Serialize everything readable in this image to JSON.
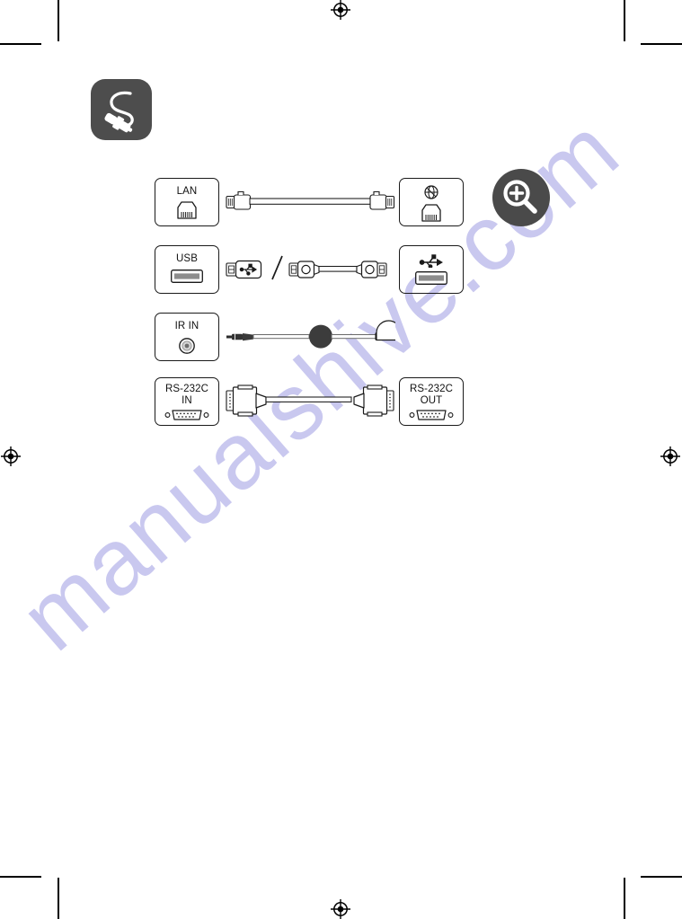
{
  "page": {
    "type": "manual-connection-guide",
    "background_color": "#ffffff",
    "ink_color": "#1a1a1a"
  },
  "watermark": {
    "text": "manualshive.com",
    "color": "#c9c8ef",
    "rotation_deg": -41
  },
  "section_badge": {
    "icon": "cable-plug-icon",
    "background_color": "#4d4d4d",
    "glyph_color": "#ffffff"
  },
  "zoom_badge": {
    "icon": "magnifier-plus-icon",
    "background_color": "#4a4a4a",
    "glyph_color": "#ffffff"
  },
  "rows": [
    {
      "id": "lan",
      "source": {
        "label": "LAN",
        "label_lines": [
          "LAN"
        ],
        "icon": "rj45-jack-icon"
      },
      "cable": {
        "icon": "lan-ethernet-cable-icon",
        "description": "RJ45 ethernet patch cable"
      },
      "destination": {
        "label": "",
        "label_lines": [],
        "icon": "globe-network-rj45-icon"
      }
    },
    {
      "id": "usb",
      "source": {
        "label": "USB",
        "label_lines": [
          "USB"
        ],
        "icon": "usb-type-a-port-icon"
      },
      "cable": {
        "icon": "usb-flash-drive-and-usb-cable-icon",
        "separator": "/",
        "description": "USB flash drive or USB A-to-A cable"
      },
      "destination": {
        "label": "",
        "label_lines": [],
        "icon": "usb-trident-port-icon"
      }
    },
    {
      "id": "ir-in",
      "source": {
        "label": "IR IN",
        "label_lines": [
          "IR IN"
        ],
        "icon": "mini-jack-port-icon"
      },
      "cable": {
        "icon": "ir-receiver-cable-icon",
        "description": "3.5 mm plug, ferrite bead, IR receiver dome"
      },
      "destination": null
    },
    {
      "id": "rs-232c",
      "source": {
        "label": "RS-232C IN",
        "label_lines": [
          "RS-232C",
          "IN"
        ],
        "icon": "dsub-9pin-port-icon"
      },
      "cable": {
        "icon": "rs232c-serial-cable-icon",
        "description": "D-sub 9-pin serial cable"
      },
      "destination": {
        "label": "RS-232C OUT",
        "label_lines": [
          "RS-232C",
          "OUT"
        ],
        "icon": "dsub-9pin-port-icon"
      }
    }
  ]
}
